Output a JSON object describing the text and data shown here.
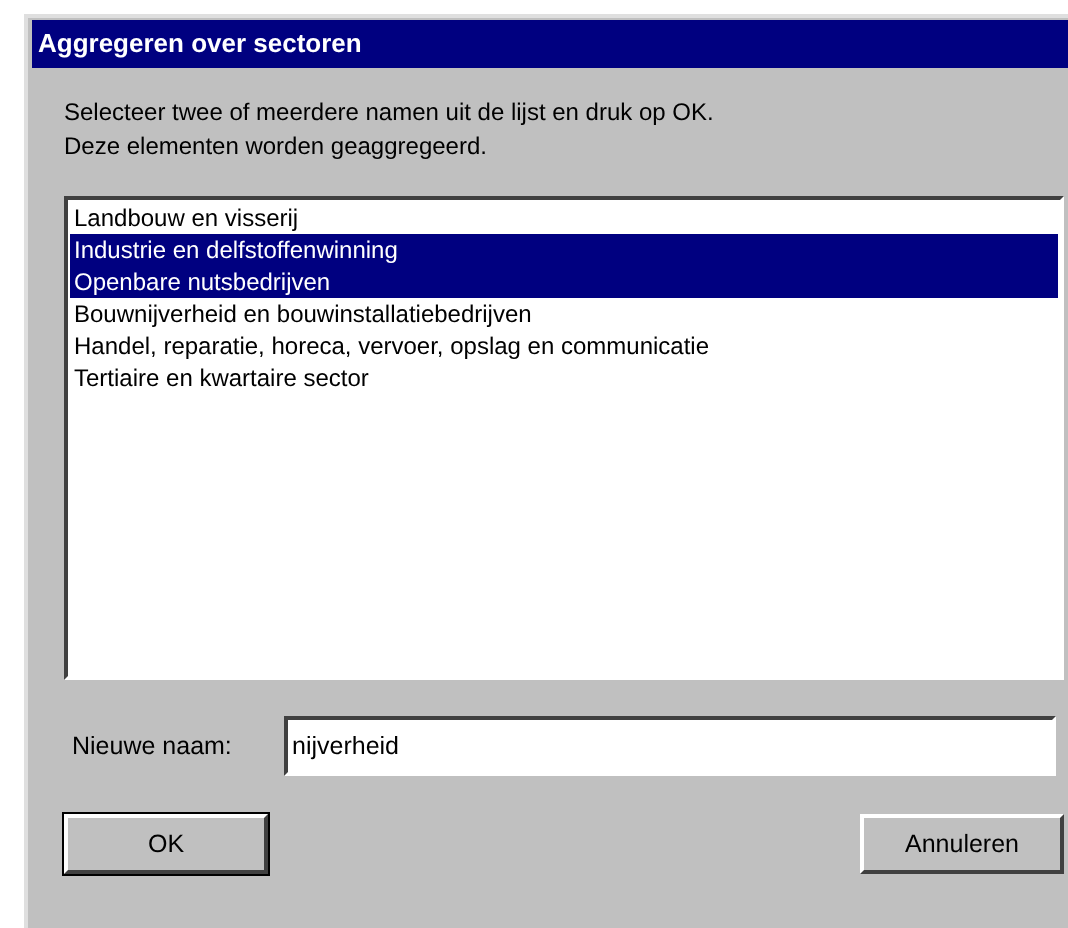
{
  "window": {
    "title": "Aggregeren over sectoren"
  },
  "instructions": [
    "Selecteer twee of meerdere namen uit de lijst en druk op OK.",
    "Deze elementen worden geaggregeerd."
  ],
  "list": {
    "items": [
      {
        "label": "Landbouw en visserij",
        "selected": false
      },
      {
        "label": "Industrie en delfstoffenwinning",
        "selected": true
      },
      {
        "label": "Openbare nutsbedrijven",
        "selected": true
      },
      {
        "label": "Bouwnijverheid en bouwinstallatiebedrijven",
        "selected": false
      },
      {
        "label": "Handel, reparatie, horeca, vervoer, opslag en communicatie",
        "selected": false
      },
      {
        "label": "Tertiaire en kwartaire sector",
        "selected": false
      }
    ]
  },
  "name_field": {
    "label": "Nieuwe naam:",
    "value": "nijverheid"
  },
  "buttons": [
    {
      "label": "OK",
      "kind": "default"
    },
    {
      "label": "Annuleren",
      "kind": "normal"
    }
  ]
}
